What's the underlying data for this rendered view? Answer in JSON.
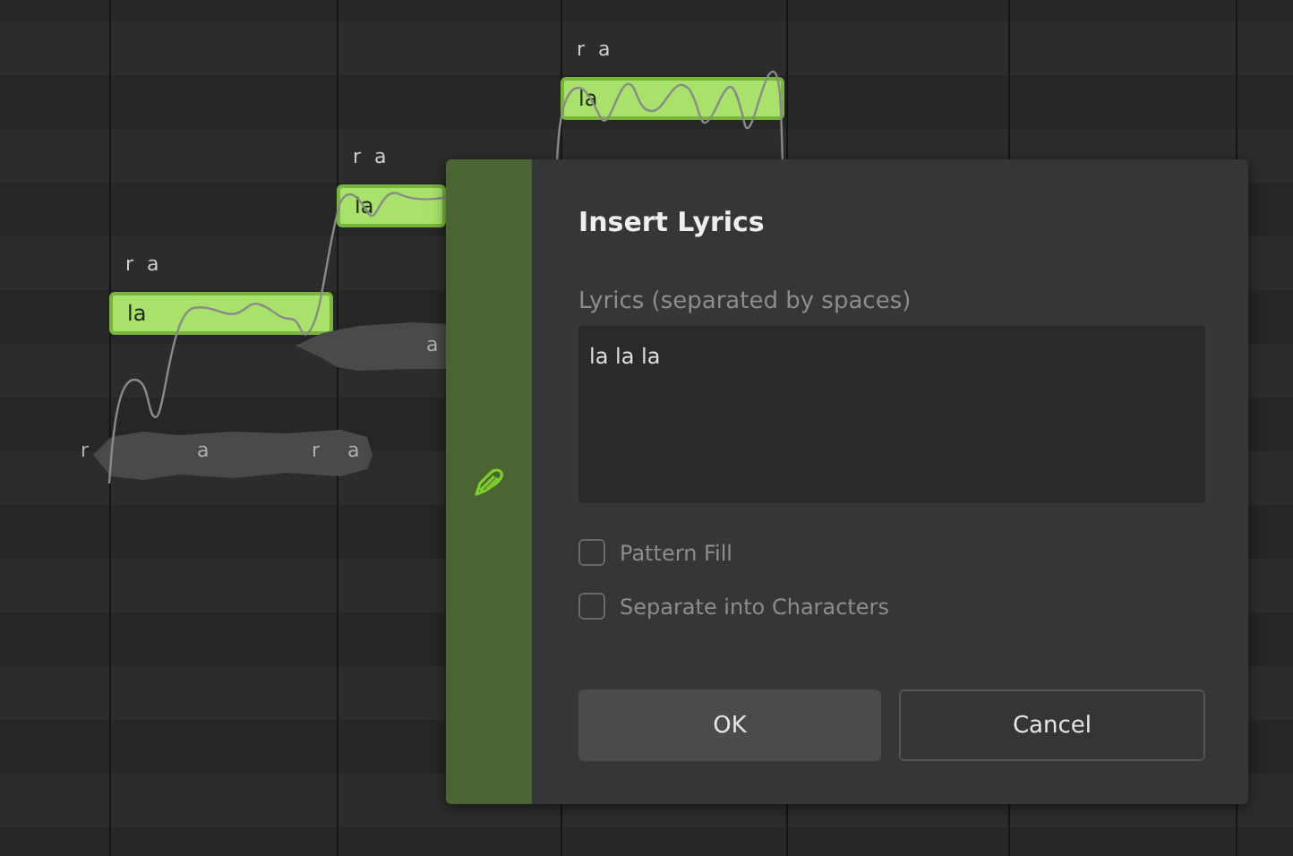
{
  "notes": [
    {
      "lyric": "la",
      "phonemes": "r a"
    },
    {
      "lyric": "la",
      "phonemes": "r a"
    },
    {
      "lyric": "la",
      "phonemes": "r a"
    }
  ],
  "phoneme_labels": [
    {
      "text": "r"
    },
    {
      "text": "a"
    },
    {
      "text": "r"
    },
    {
      "text": "a"
    },
    {
      "text": "a"
    }
  ],
  "dialog": {
    "title": "Insert Lyrics",
    "field_label": "Lyrics (separated by spaces)",
    "value": "la la la",
    "options": [
      {
        "label": "Pattern Fill",
        "checked": false
      },
      {
        "label": "Separate into Characters",
        "checked": false
      }
    ],
    "buttons": [
      {
        "label": "OK",
        "kind": "primary"
      },
      {
        "label": "Cancel",
        "kind": "secondary"
      }
    ]
  }
}
